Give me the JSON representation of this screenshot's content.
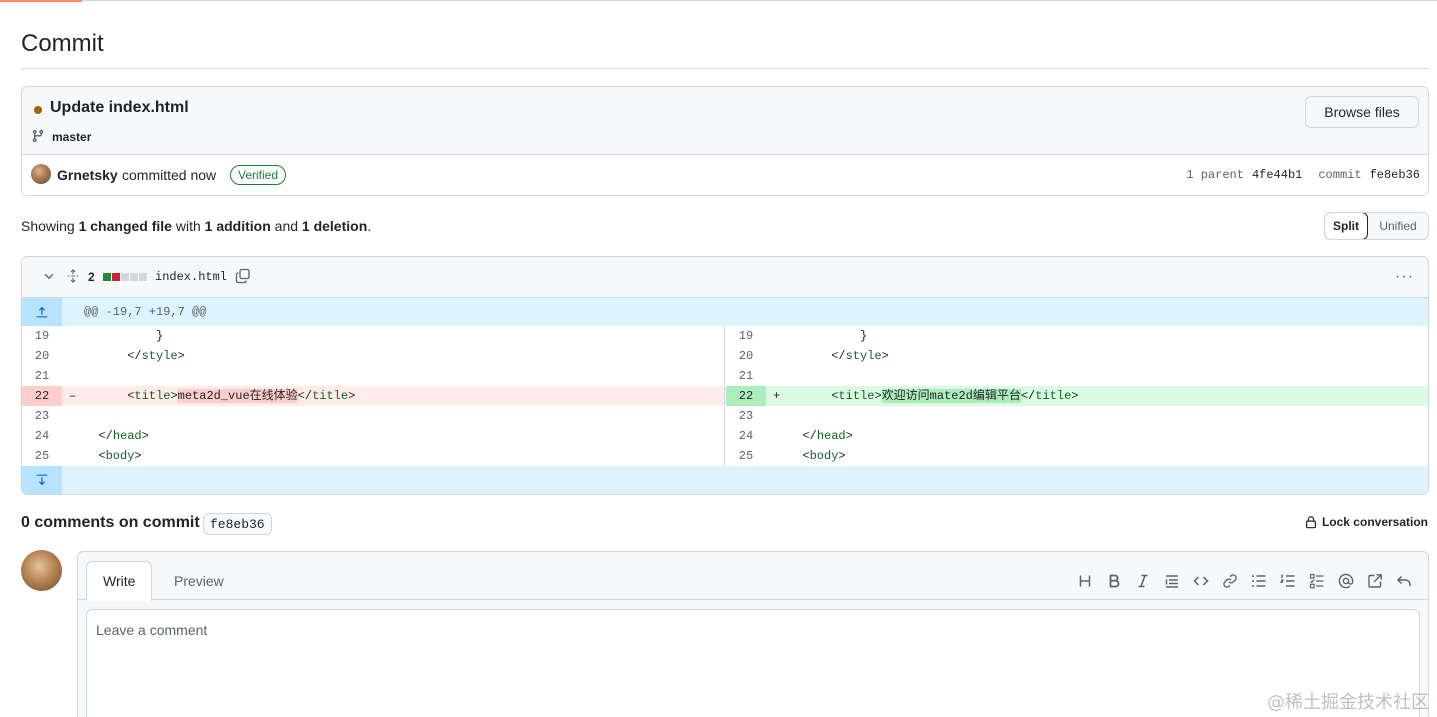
{
  "page": {
    "title": "Commit"
  },
  "commit": {
    "message": "Update index.html",
    "branch": "master",
    "browse_label": "Browse files",
    "author": "Grnetsky",
    "when": "committed now",
    "verified": "Verified",
    "parent_label": "1 parent",
    "parent_sha": "4fe44b1",
    "commit_label": "commit",
    "commit_sha": "fe8eb36",
    "status_color": "#9a6700"
  },
  "summary": {
    "showing": "Showing",
    "files": "1 changed file",
    "with": "with",
    "additions": "1 addition",
    "and": "and",
    "deletions": "1 deletion",
    "end": "."
  },
  "view_toggle": {
    "split": "Split",
    "unified": "Unified",
    "selected": "Split"
  },
  "diff": {
    "count": "2",
    "filename": "index.html",
    "hunk_header": "@@ -19,7 +19,7 @@",
    "left": [
      {
        "ln": "19",
        "sign": "",
        "pre": "          }",
        "hl": "",
        "post": "",
        "type": "ctx"
      },
      {
        "ln": "20",
        "sign": "",
        "pre": "      </style>",
        "hl": "",
        "post": "",
        "type": "ctx"
      },
      {
        "ln": "21",
        "sign": "",
        "pre": "",
        "hl": "",
        "post": "",
        "type": "ctx"
      },
      {
        "ln": "22",
        "sign": "–",
        "pre": "      <title>",
        "hl": "meta2d_vue在线体验",
        "post": "</title>",
        "type": "del"
      },
      {
        "ln": "23",
        "sign": "",
        "pre": "",
        "hl": "",
        "post": "",
        "type": "ctx"
      },
      {
        "ln": "24",
        "sign": "",
        "pre": "  </head>",
        "hl": "",
        "post": "",
        "type": "ctx"
      },
      {
        "ln": "25",
        "sign": "",
        "pre": "  <body>",
        "hl": "",
        "post": "",
        "type": "ctx"
      }
    ],
    "right": [
      {
        "ln": "19",
        "sign": "",
        "pre": "          }",
        "hl": "",
        "post": "",
        "type": "ctx"
      },
      {
        "ln": "20",
        "sign": "",
        "pre": "      </style>",
        "hl": "",
        "post": "",
        "type": "ctx"
      },
      {
        "ln": "21",
        "sign": "",
        "pre": "",
        "hl": "",
        "post": "",
        "type": "ctx"
      },
      {
        "ln": "22",
        "sign": "+",
        "pre": "      <title>",
        "hl": "欢迎访问mate2d编辑平台",
        "post": "</title>",
        "type": "add"
      },
      {
        "ln": "23",
        "sign": "",
        "pre": "",
        "hl": "",
        "post": "",
        "type": "ctx"
      },
      {
        "ln": "24",
        "sign": "",
        "pre": "  </head>",
        "hl": "",
        "post": "",
        "type": "ctx"
      },
      {
        "ln": "25",
        "sign": "",
        "pre": "  <body>",
        "hl": "",
        "post": "",
        "type": "ctx"
      }
    ]
  },
  "comments": {
    "title": "0 comments on commit",
    "sha": "fe8eb36",
    "lock_label": "Lock conversation"
  },
  "editor": {
    "write_tab": "Write",
    "preview_tab": "Preview",
    "placeholder": "Leave a comment",
    "toolbar": [
      "heading-icon",
      "bold-icon",
      "italic-icon",
      "quote-icon",
      "code-icon",
      "link-icon",
      "unordered-list-icon",
      "ordered-list-icon",
      "task-list-icon",
      "mention-icon",
      "reference-icon",
      "undo-icon"
    ]
  },
  "watermark": "@稀土掘金技术社区"
}
